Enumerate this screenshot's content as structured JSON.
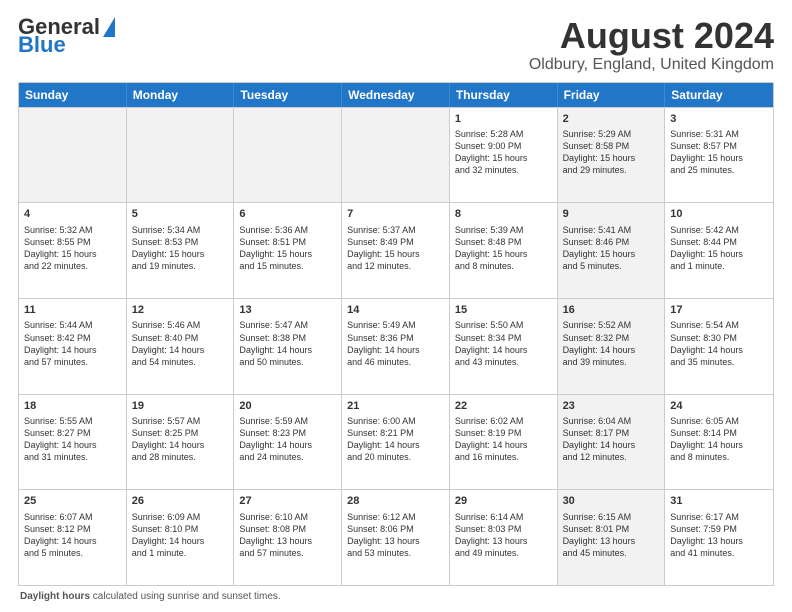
{
  "title": "August 2024",
  "subtitle": "Oldbury, England, United Kingdom",
  "logo": {
    "line1": "General",
    "line2": "Blue"
  },
  "days_of_week": [
    "Sunday",
    "Monday",
    "Tuesday",
    "Wednesday",
    "Thursday",
    "Friday",
    "Saturday"
  ],
  "bottom_note_label": "Daylight hours",
  "weeks": [
    [
      {
        "day": "",
        "info": "",
        "shaded": true
      },
      {
        "day": "",
        "info": "",
        "shaded": true
      },
      {
        "day": "",
        "info": "",
        "shaded": true
      },
      {
        "day": "",
        "info": "",
        "shaded": true
      },
      {
        "day": "1",
        "info": "Sunrise: 5:28 AM\nSunset: 9:00 PM\nDaylight: 15 hours\nand 32 minutes.",
        "shaded": false
      },
      {
        "day": "2",
        "info": "Sunrise: 5:29 AM\nSunset: 8:58 PM\nDaylight: 15 hours\nand 29 minutes.",
        "shaded": true
      },
      {
        "day": "3",
        "info": "Sunrise: 5:31 AM\nSunset: 8:57 PM\nDaylight: 15 hours\nand 25 minutes.",
        "shaded": false
      }
    ],
    [
      {
        "day": "4",
        "info": "Sunrise: 5:32 AM\nSunset: 8:55 PM\nDaylight: 15 hours\nand 22 minutes.",
        "shaded": false
      },
      {
        "day": "5",
        "info": "Sunrise: 5:34 AM\nSunset: 8:53 PM\nDaylight: 15 hours\nand 19 minutes.",
        "shaded": false
      },
      {
        "day": "6",
        "info": "Sunrise: 5:36 AM\nSunset: 8:51 PM\nDaylight: 15 hours\nand 15 minutes.",
        "shaded": false
      },
      {
        "day": "7",
        "info": "Sunrise: 5:37 AM\nSunset: 8:49 PM\nDaylight: 15 hours\nand 12 minutes.",
        "shaded": false
      },
      {
        "day": "8",
        "info": "Sunrise: 5:39 AM\nSunset: 8:48 PM\nDaylight: 15 hours\nand 8 minutes.",
        "shaded": false
      },
      {
        "day": "9",
        "info": "Sunrise: 5:41 AM\nSunset: 8:46 PM\nDaylight: 15 hours\nand 5 minutes.",
        "shaded": true
      },
      {
        "day": "10",
        "info": "Sunrise: 5:42 AM\nSunset: 8:44 PM\nDaylight: 15 hours\nand 1 minute.",
        "shaded": false
      }
    ],
    [
      {
        "day": "11",
        "info": "Sunrise: 5:44 AM\nSunset: 8:42 PM\nDaylight: 14 hours\nand 57 minutes.",
        "shaded": false
      },
      {
        "day": "12",
        "info": "Sunrise: 5:46 AM\nSunset: 8:40 PM\nDaylight: 14 hours\nand 54 minutes.",
        "shaded": false
      },
      {
        "day": "13",
        "info": "Sunrise: 5:47 AM\nSunset: 8:38 PM\nDaylight: 14 hours\nand 50 minutes.",
        "shaded": false
      },
      {
        "day": "14",
        "info": "Sunrise: 5:49 AM\nSunset: 8:36 PM\nDaylight: 14 hours\nand 46 minutes.",
        "shaded": false
      },
      {
        "day": "15",
        "info": "Sunrise: 5:50 AM\nSunset: 8:34 PM\nDaylight: 14 hours\nand 43 minutes.",
        "shaded": false
      },
      {
        "day": "16",
        "info": "Sunrise: 5:52 AM\nSunset: 8:32 PM\nDaylight: 14 hours\nand 39 minutes.",
        "shaded": true
      },
      {
        "day": "17",
        "info": "Sunrise: 5:54 AM\nSunset: 8:30 PM\nDaylight: 14 hours\nand 35 minutes.",
        "shaded": false
      }
    ],
    [
      {
        "day": "18",
        "info": "Sunrise: 5:55 AM\nSunset: 8:27 PM\nDaylight: 14 hours\nand 31 minutes.",
        "shaded": false
      },
      {
        "day": "19",
        "info": "Sunrise: 5:57 AM\nSunset: 8:25 PM\nDaylight: 14 hours\nand 28 minutes.",
        "shaded": false
      },
      {
        "day": "20",
        "info": "Sunrise: 5:59 AM\nSunset: 8:23 PM\nDaylight: 14 hours\nand 24 minutes.",
        "shaded": false
      },
      {
        "day": "21",
        "info": "Sunrise: 6:00 AM\nSunset: 8:21 PM\nDaylight: 14 hours\nand 20 minutes.",
        "shaded": false
      },
      {
        "day": "22",
        "info": "Sunrise: 6:02 AM\nSunset: 8:19 PM\nDaylight: 14 hours\nand 16 minutes.",
        "shaded": false
      },
      {
        "day": "23",
        "info": "Sunrise: 6:04 AM\nSunset: 8:17 PM\nDaylight: 14 hours\nand 12 minutes.",
        "shaded": true
      },
      {
        "day": "24",
        "info": "Sunrise: 6:05 AM\nSunset: 8:14 PM\nDaylight: 14 hours\nand 8 minutes.",
        "shaded": false
      }
    ],
    [
      {
        "day": "25",
        "info": "Sunrise: 6:07 AM\nSunset: 8:12 PM\nDaylight: 14 hours\nand 5 minutes.",
        "shaded": false
      },
      {
        "day": "26",
        "info": "Sunrise: 6:09 AM\nSunset: 8:10 PM\nDaylight: 14 hours\nand 1 minute.",
        "shaded": false
      },
      {
        "day": "27",
        "info": "Sunrise: 6:10 AM\nSunset: 8:08 PM\nDaylight: 13 hours\nand 57 minutes.",
        "shaded": false
      },
      {
        "day": "28",
        "info": "Sunrise: 6:12 AM\nSunset: 8:06 PM\nDaylight: 13 hours\nand 53 minutes.",
        "shaded": false
      },
      {
        "day": "29",
        "info": "Sunrise: 6:14 AM\nSunset: 8:03 PM\nDaylight: 13 hours\nand 49 minutes.",
        "shaded": false
      },
      {
        "day": "30",
        "info": "Sunrise: 6:15 AM\nSunset: 8:01 PM\nDaylight: 13 hours\nand 45 minutes.",
        "shaded": true
      },
      {
        "day": "31",
        "info": "Sunrise: 6:17 AM\nSunset: 7:59 PM\nDaylight: 13 hours\nand 41 minutes.",
        "shaded": false
      }
    ]
  ]
}
